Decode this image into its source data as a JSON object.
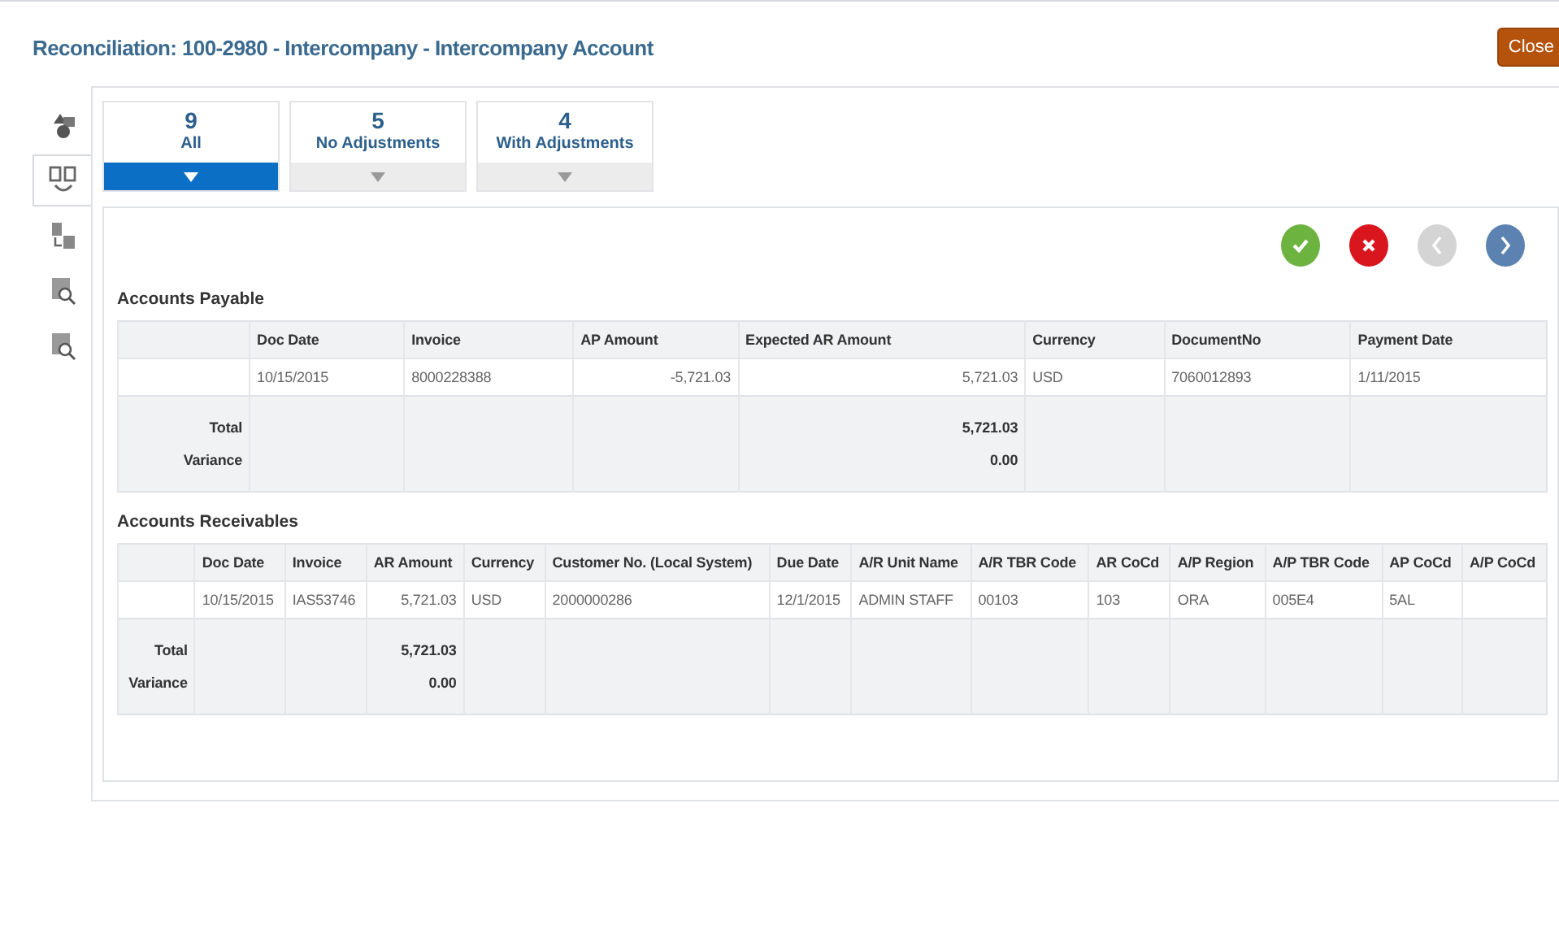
{
  "header": {
    "title": "Reconciliation: 100-2980 - Intercompany - Intercompany Account",
    "close_button": "Close"
  },
  "side_nav": [
    {
      "kind": "shapes",
      "selected": false
    },
    {
      "kind": "match",
      "selected": true
    },
    {
      "kind": "transfer",
      "selected": false
    },
    {
      "kind": "inspect",
      "selected": false
    },
    {
      "kind": "inspect",
      "selected": false
    }
  ],
  "tabs": [
    {
      "count": "9",
      "label": "All",
      "selected": true
    },
    {
      "count": "5",
      "label": "No Adjustments",
      "selected": false
    },
    {
      "count": "4",
      "label": "With Adjustments",
      "selected": false
    }
  ],
  "actions": [
    {
      "kind": "approve",
      "disabled": false
    },
    {
      "kind": "reject",
      "disabled": false
    },
    {
      "kind": "previous",
      "disabled": true
    },
    {
      "kind": "next",
      "disabled": false
    }
  ],
  "sections": [
    {
      "title": "Accounts Payable",
      "summary_labels": [
        "Total",
        "Variance"
      ],
      "columns": [
        {
          "label": "Doc Date",
          "kind": "text"
        },
        {
          "label": "Invoice",
          "kind": "text"
        },
        {
          "label": "AP Amount",
          "kind": "amount"
        },
        {
          "label": "Expected AR Amount",
          "kind": "amount",
          "total": "5,721.03",
          "variance": "0.00"
        },
        {
          "label": "Currency",
          "kind": "text"
        },
        {
          "label": "DocumentNo",
          "kind": "text"
        },
        {
          "label": "Payment Date",
          "kind": "text"
        }
      ],
      "rows": [
        [
          "10/15/2015",
          "8000228388",
          "-5,721.03",
          "5,721.03",
          "USD",
          "7060012893",
          "1/11/2015"
        ]
      ]
    },
    {
      "title": "Accounts Receivables",
      "summary_labels": [
        "Total",
        "Variance"
      ],
      "columns": [
        {
          "label": "Doc Date",
          "kind": "text"
        },
        {
          "label": "Invoice",
          "kind": "text"
        },
        {
          "label": "AR Amount",
          "kind": "amount",
          "total": "5,721.03",
          "variance": "0.00"
        },
        {
          "label": "Currency",
          "kind": "text"
        },
        {
          "label": "Customer No. (Local System)",
          "kind": "text"
        },
        {
          "label": "Due Date",
          "kind": "text"
        },
        {
          "label": "A/R Unit Name",
          "kind": "text"
        },
        {
          "label": "A/R TBR Code",
          "kind": "text"
        },
        {
          "label": "AR CoCd",
          "kind": "text"
        },
        {
          "label": "A/P Region",
          "kind": "text"
        },
        {
          "label": "A/P TBR Code",
          "kind": "text"
        },
        {
          "label": "AP CoCd",
          "kind": "text"
        },
        {
          "label": "A/P CoCd",
          "kind": "text"
        }
      ],
      "rows": [
        [
          "10/15/2015",
          "IAS53746",
          "5,721.03",
          "USD",
          "2000000286",
          "12/1/2015",
          "ADMIN STAFF",
          "00103",
          "103",
          "ORA",
          "005E4",
          "5AL",
          null
        ]
      ]
    }
  ]
}
